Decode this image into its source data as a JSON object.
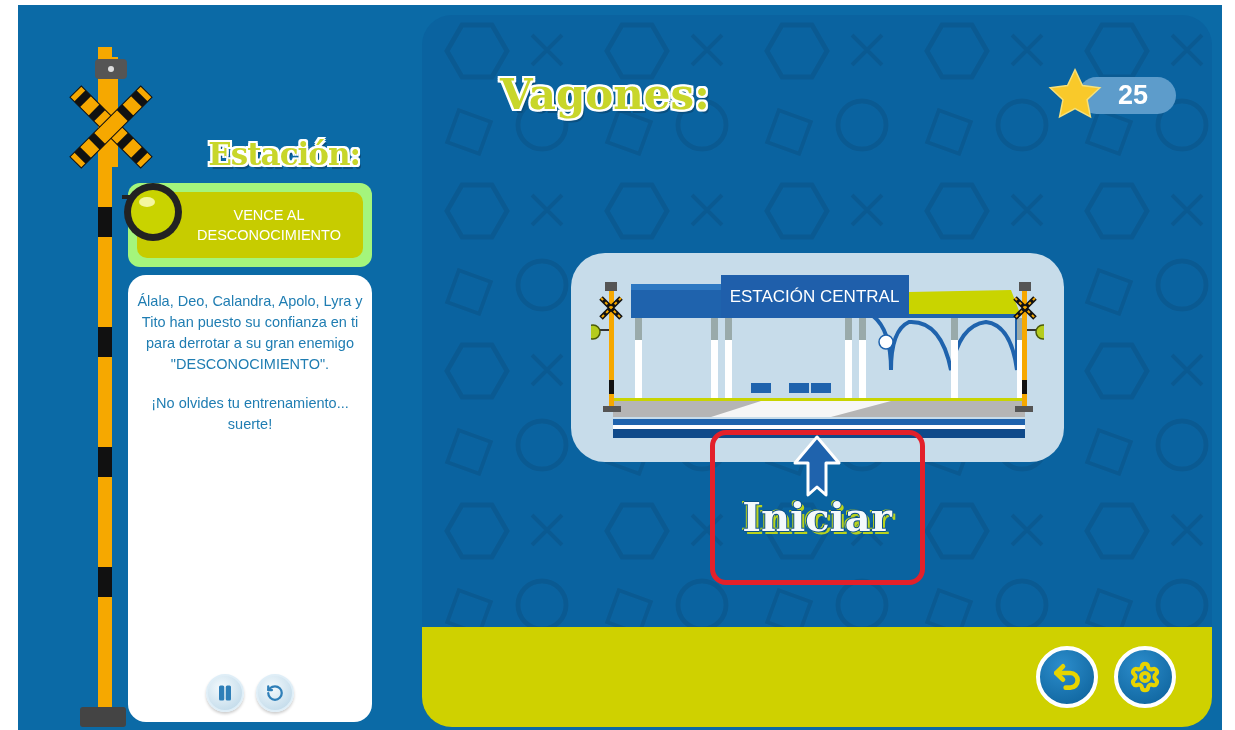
{
  "station": {
    "title": "Estación:",
    "banner": "VENCE AL DESCONOCIMIENTO",
    "message": [
      "Álala, Deo, Calandra, Apolo, Lyra y Tito han puesto su confianza en ti para derrotar a su gran enemigo \"DESCONOCIMIENTO\".",
      "¡No olvides tu entrenamiento... suerte!"
    ],
    "controls": [
      {
        "kind": "pause"
      },
      {
        "kind": "restart"
      }
    ]
  },
  "game": {
    "title": "Vagones:",
    "score": "25",
    "station_sign": "ESTACIÓN CENTRAL",
    "start_label": "Iniciar",
    "highlighted": true,
    "footer_buttons": [
      {
        "kind": "back"
      },
      {
        "kind": "settings"
      }
    ]
  }
}
